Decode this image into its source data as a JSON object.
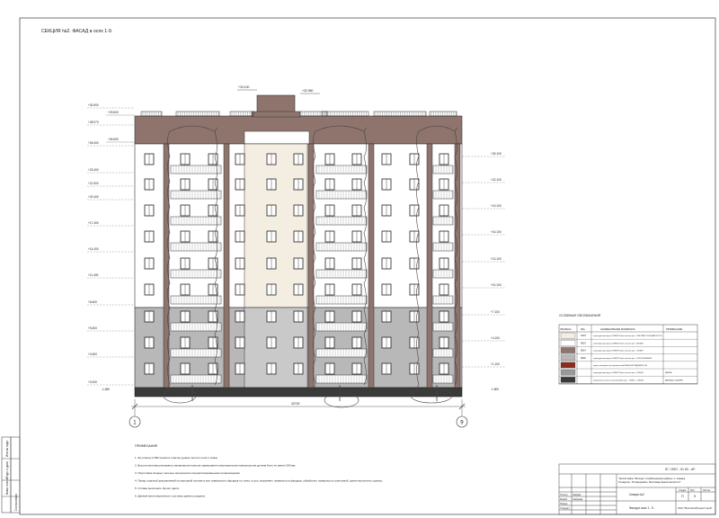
{
  "sheet_title": "СЕКЦИЯ №2. ФАСАД в осях 1-9.",
  "axes": {
    "left": "1",
    "right": "9"
  },
  "width_dimension": "32700",
  "roof_marks": {
    "upper_left": "+33.100",
    "upper_right": "+32.950"
  },
  "left_marks": [
    "+30.900",
    "+28.970",
    "+26.400",
    "+23.400",
    "+21.900",
    "+20.400",
    "+17.400",
    "+14.400",
    "+11.400",
    "+8.400",
    "+5.400",
    "+2.600",
    "+0.000"
  ],
  "left_extra": [
    "+29.600",
    "+26.500"
  ],
  "ground_left": "-1.650",
  "ground_right": "-1.800",
  "right_marks": [
    "+25.100",
    "+22.100",
    "+19.100",
    "+16.100",
    "+13.100",
    "+10.100",
    "+7.100",
    "+4.100",
    "+1.100"
  ],
  "legend": {
    "title": "УСЛОВНЫЕ ОБОЗНАЧЕНИЯ",
    "headers": [
      "ОБОЗНАЧ.",
      "RAL",
      "НАИМЕНОВАНИЕ МАТЕРИАЛА",
      "ПРИМЕЧАНИЕ"
    ],
    "rows": [
      {
        "color": "#f4ede2",
        "ral": "1015",
        "name": "штукатурка фасадная CERESIT (или аналог) цвет - СВЕТЛАЯ СЛОНОВАЯ КОСТЬ",
        "note": ""
      },
      {
        "color": "#ffffff",
        "ral": "9010",
        "name": "штукатурка фасадная CERESIT (или аналог) цвет - БЕЛЫЙ",
        "note": ""
      },
      {
        "color": "#8e746c",
        "ral": "8014",
        "name": "штукатурка фасадная CERESIT (или аналог) цвет - СЕПИЯ",
        "note": ""
      },
      {
        "color": "#b8b8b8",
        "ral": "9002",
        "name": "штукатурка фасадная CERESIT (или аналог) цвет - СЕРО-БЕЖЕВЫЙ",
        "note": ""
      },
      {
        "color": "#8a2c20",
        "ral": "",
        "name": "кирпич облицовочный керамический КРАСНЫЙ ГЛАДКИЙ М-150",
        "note": ""
      },
      {
        "color": "#9a9a9a",
        "ral": "",
        "name": "штукатурка фасадная CERESIT (или аналог) цвет - СЕРЫЙ",
        "note": "цоколь"
      },
      {
        "color": "#3a3a3a",
        "ral": "",
        "name": "керамогранит (или аналог) 600х600 цвет - ОНИКС - СЕРЫЙ",
        "note": "крыльцо, ступени"
      }
    ]
  },
  "notes": {
    "title": "ПРИМЕЧАНИЕ",
    "items": [
      "1.   За отметку 0.000 принята отметка уровня чистого пола 1 этажа.",
      "2.   Высота монтажа рекламных материалов в местах примыкания к вертикальным поверхностям должна быть не менее 200 мм.",
      "3.   Подготовка входных зеленых материалов специализированными организациями.",
      "4.   Перед отделкой декоративной штукатуркой положить все поверхности фасадов по тонко и сухо, выровнять поверхности фасадов, обработать поверхность грунтовкой, далее выполнить отделку.",
      "5.   Отливы выполнить белого цвета.",
      "6.   Данный вентиляционные и системы данного раздела."
    ]
  },
  "title_block": {
    "code": "57 / 2007 - 01 КЗ - АР",
    "project": "\"Жилой район \"Волгарь\" в Куйбышевском районе г.о. Самара. 15 квартал. 15 микрорайон. Многоквартирный жилой №7\"",
    "section": "Секция №2",
    "stage_headers": [
      "Стадия",
      "Лист",
      "Листов"
    ],
    "stage": "П",
    "sheet": "9",
    "drawing": "Фасад в осях 1 - 9.",
    "org": "ООО \"ВолгаТехПроектСтрой\"",
    "roles": [
      "Н.контр.",
      "Разраб.",
      "Провер.",
      "Утвердил"
    ],
    "names": [
      "Уварова",
      "Смирнова"
    ]
  },
  "side_strip": [
    "Инв.№ подл.",
    "Подп. и дата",
    "Взам. инв.№",
    "Согласовано"
  ]
}
